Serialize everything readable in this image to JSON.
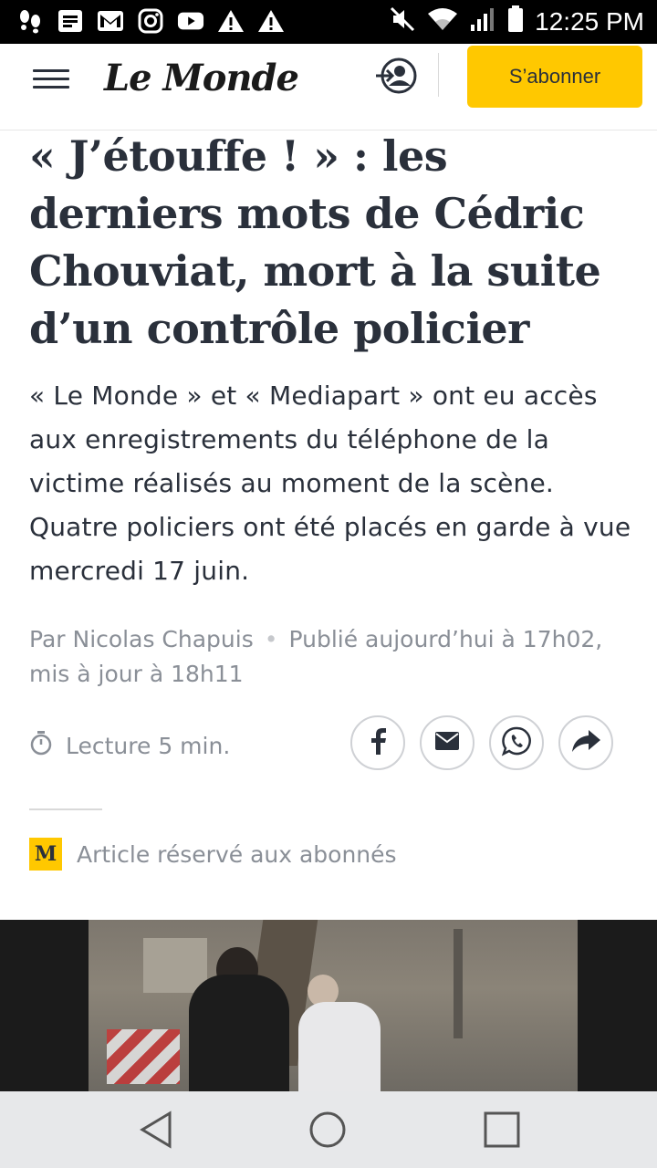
{
  "status_bar": {
    "time": "12:25 PM",
    "icons": [
      "shoe-prints-icon",
      "message-icon",
      "gmail-icon",
      "instagram-icon",
      "youtube-icon",
      "warning-icon",
      "warning-icon",
      "mute-icon",
      "wifi-icon",
      "signal-icon",
      "battery-icon"
    ]
  },
  "header": {
    "logo": "Le Monde",
    "subscribe_label": "S’abonner",
    "menu_icon": "hamburger-menu-icon",
    "login_icon": "login-icon"
  },
  "article": {
    "title": "« J’étouffe ! » : les derniers mots de Cédric Chouviat, mort à la suite d’un contrôle policier",
    "lead": "« Le Monde » et « Mediapart » ont eu accès aux enregistrements du téléphone de la victime réalisés au moment de la scène. Quatre policiers ont été placés en garde à vue mercredi 17 juin.",
    "author": "Par Nicolas Chapuis",
    "published": "Publié aujourd’hui à 17h02, mis à jour à 18h11",
    "reading_time": "Lecture 5 min.",
    "premium_badge": "M",
    "premium_label": "Article réservé aux abonnés"
  },
  "share": {
    "buttons": [
      "facebook-icon",
      "email-icon",
      "whatsapp-icon",
      "share-icon"
    ]
  },
  "colors": {
    "accent": "#ffc800",
    "text": "#2a303b",
    "muted": "#8a8f97"
  },
  "navigation": {
    "back_icon": "back-triangle-icon",
    "home_icon": "home-circle-icon",
    "recents_icon": "recents-square-icon"
  }
}
